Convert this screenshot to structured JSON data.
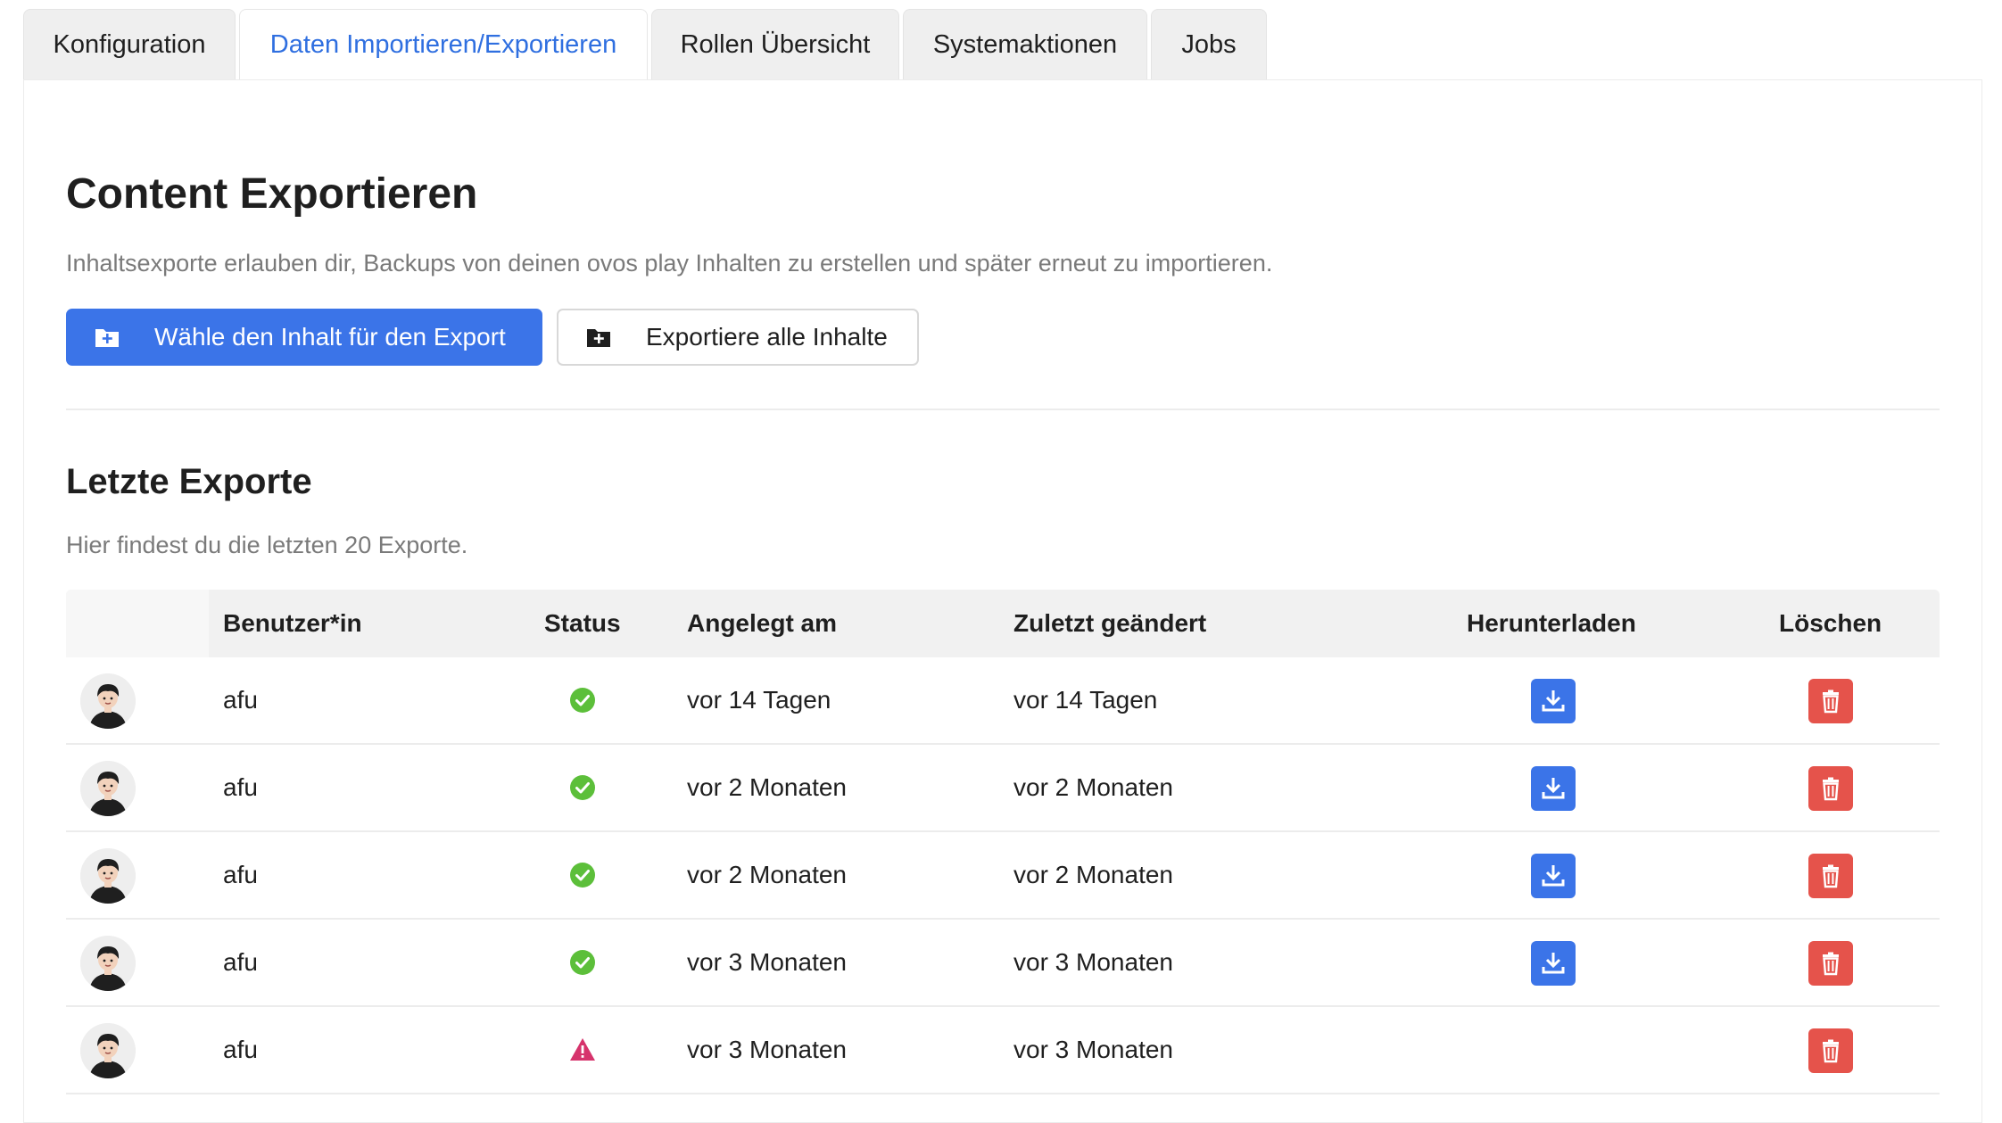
{
  "tabs": [
    {
      "label": "Konfiguration",
      "active": false
    },
    {
      "label": "Daten Importieren/Exportieren",
      "active": true
    },
    {
      "label": "Rollen Übersicht",
      "active": false
    },
    {
      "label": "Systemaktionen",
      "active": false
    },
    {
      "label": "Jobs",
      "active": false
    }
  ],
  "export": {
    "title": "Content Exportieren",
    "description": "Inhaltsexporte erlauben dir, Backups von deinen ovos play Inhalten zu erstellen und später erneut zu importieren.",
    "choose_button": "Wähle den Inhalt für den Export",
    "export_all_button": "Exportiere alle Inhalte"
  },
  "recent": {
    "title": "Letzte Exporte",
    "description": "Hier findest du die letzten 20 Exporte.",
    "columns": {
      "user": "Benutzer*in",
      "status": "Status",
      "created": "Angelegt am",
      "modified": "Zuletzt geändert",
      "download": "Herunterladen",
      "delete": "Löschen"
    },
    "rows": [
      {
        "user": "afu",
        "status": "success",
        "created": "vor 14 Tagen",
        "modified": "vor 14 Tagen",
        "downloadable": true
      },
      {
        "user": "afu",
        "status": "success",
        "created": "vor 2 Monaten",
        "modified": "vor 2 Monaten",
        "downloadable": true
      },
      {
        "user": "afu",
        "status": "success",
        "created": "vor 2 Monaten",
        "modified": "vor 2 Monaten",
        "downloadable": true
      },
      {
        "user": "afu",
        "status": "success",
        "created": "vor 3 Monaten",
        "modified": "vor 3 Monaten",
        "downloadable": true
      },
      {
        "user": "afu",
        "status": "warning",
        "created": "vor 3 Monaten",
        "modified": "vor 3 Monaten",
        "downloadable": false
      }
    ]
  },
  "colors": {
    "accent": "#3b74e8",
    "danger": "#e5534b",
    "success": "#5cbf3a",
    "warning": "#d6336c"
  }
}
